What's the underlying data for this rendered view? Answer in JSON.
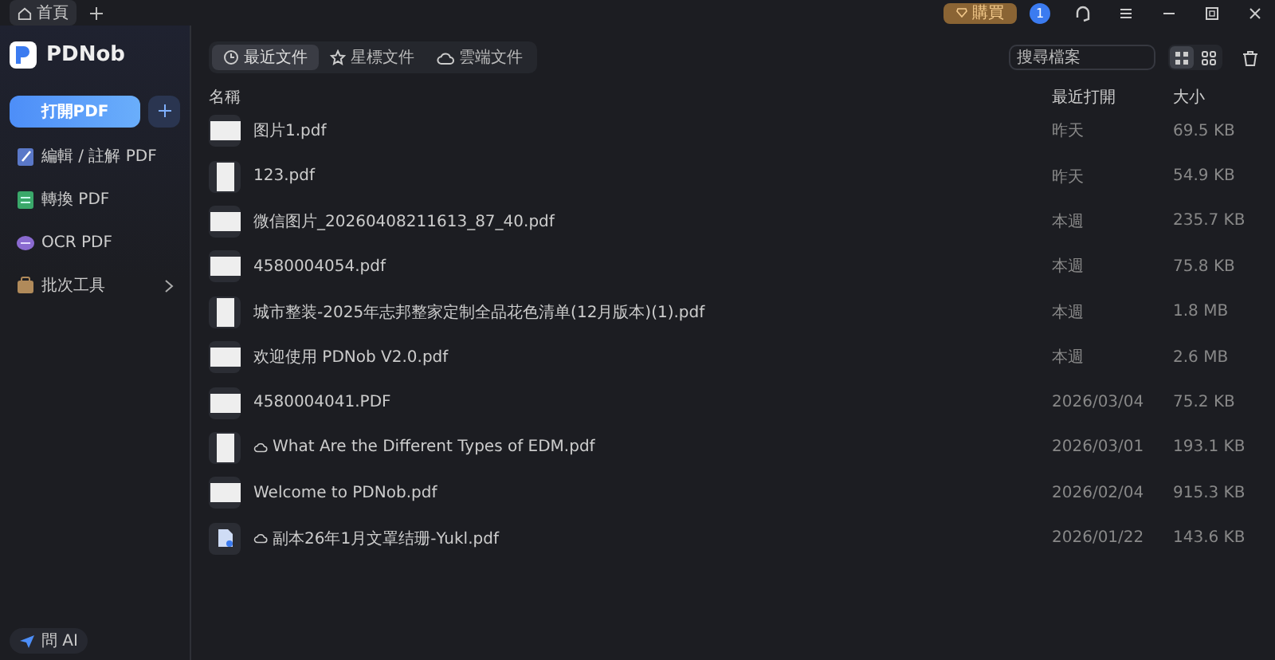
{
  "window_tabs": [
    {
      "label": "首頁",
      "selected": true
    }
  ],
  "title_bar": {
    "buy_label": "購買",
    "notification_count": "1"
  },
  "sidebar": {
    "app_name": "PDNob",
    "open_button": "打開PDF",
    "items": [
      {
        "kind": "edit",
        "label": "編輯 / 註解 PDF",
        "expandable": false
      },
      {
        "kind": "convert",
        "label": "轉換 PDF",
        "expandable": false
      },
      {
        "kind": "ocr",
        "label": "OCR PDF",
        "expandable": false
      },
      {
        "kind": "batch",
        "label": "批次工具",
        "expandable": true
      }
    ],
    "ai_button": "問 AI"
  },
  "file_tabs": [
    {
      "kind": "recent",
      "label": "最近文件",
      "selected": true
    },
    {
      "kind": "star",
      "label": "星標文件",
      "selected": false
    },
    {
      "kind": "cloud",
      "label": "雲端文件",
      "selected": false
    }
  ],
  "search": {
    "placeholder": "搜尋檔案"
  },
  "view_modes": [
    {
      "kind": "list",
      "selected": true
    },
    {
      "kind": "grid",
      "selected": false
    }
  ],
  "table": {
    "columns": [
      "名稱",
      "最近打開",
      "大小"
    ],
    "rows": [
      {
        "kind": "landscape",
        "cloud": false,
        "name": "图片1.pdf",
        "opened": "昨天",
        "size": "69.5 KB"
      },
      {
        "kind": "portrait",
        "cloud": false,
        "name": "123.pdf",
        "opened": "昨天",
        "size": "54.9 KB"
      },
      {
        "kind": "landscape",
        "cloud": false,
        "name": "微信图片_20260408211613_87_40.pdf",
        "opened": "本週",
        "size": "235.7 KB"
      },
      {
        "kind": "landscape",
        "cloud": false,
        "name": "4580004054.pdf",
        "opened": "本週",
        "size": "75.8 KB"
      },
      {
        "kind": "portrait",
        "cloud": false,
        "name": "城市整装-2025年志邦整家定制全品花色清单(12月版本)(1).pdf",
        "opened": "本週",
        "size": "1.8 MB"
      },
      {
        "kind": "landscape",
        "cloud": false,
        "name": "欢迎使用 PDNob V2.0.pdf",
        "opened": "本週",
        "size": "2.6 MB"
      },
      {
        "kind": "landscape",
        "cloud": false,
        "name": "4580004041.PDF",
        "opened": "2026/03/04",
        "size": "75.2 KB"
      },
      {
        "kind": "portrait",
        "cloud": true,
        "name": "What Are the Different Types of EDM.pdf",
        "opened": "2026/03/01",
        "size": "193.1 KB"
      },
      {
        "kind": "landscape",
        "cloud": false,
        "name": "Welcome to PDNob.pdf",
        "opened": "2026/02/04",
        "size": "915.3 KB"
      },
      {
        "kind": "file",
        "cloud": true,
        "name": "副本26年1月文罩结珊-Yukl.pdf",
        "opened": "2026/01/22",
        "size": "143.6 KB"
      }
    ]
  }
}
